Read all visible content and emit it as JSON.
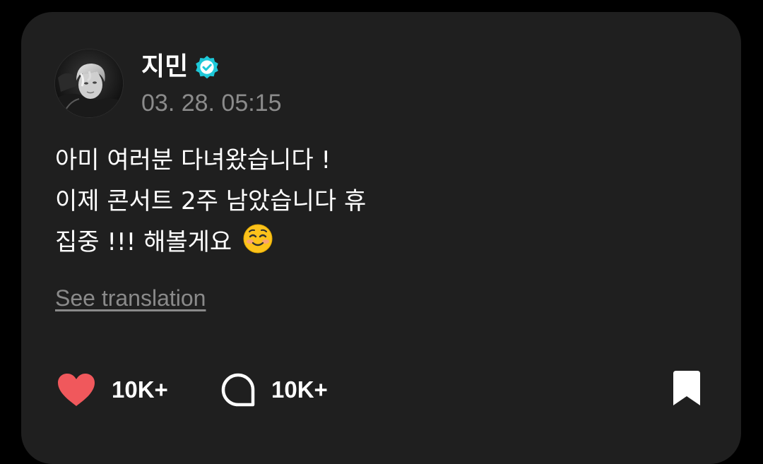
{
  "post": {
    "author": "지민",
    "timestamp": "03. 28. 05:15",
    "lines": [
      "아미 여러분 다녀왔습니다 !",
      "이제 콘서트 2주 남았습니다 휴",
      "집중 !!! 해볼게요"
    ],
    "translation_label": "See translation"
  },
  "actions": {
    "likes": "10K+",
    "comments": "10K+"
  },
  "colors": {
    "card_background": "#1f1f1f",
    "verified_badge": "#1ec8d8",
    "heart": "#f0585c",
    "muted_text": "#8b8b8b"
  },
  "icons": {
    "verified": "verified-check-icon",
    "like": "heart-icon",
    "comment": "comment-bubble-icon",
    "bookmark": "bookmark-icon",
    "emoji": "smiling-face-emoji"
  }
}
